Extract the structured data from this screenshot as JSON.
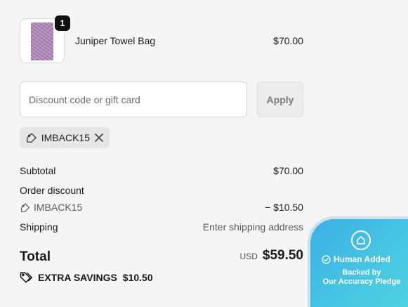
{
  "line_item": {
    "quantity": "1",
    "name": "Juniper Towel Bag",
    "price": "$70.00"
  },
  "discount": {
    "placeholder": "Discount code or gift card",
    "apply_label": "Apply",
    "applied_code": "IMBACK15"
  },
  "summary": {
    "subtotal_label": "Subtotal",
    "subtotal_value": "$70.00",
    "order_discount_label": "Order discount",
    "order_discount_code": "IMBACK15",
    "order_discount_value": "− $10.50",
    "shipping_label": "Shipping",
    "shipping_value": "Enter shipping address",
    "total_label": "Total",
    "total_currency": "USD",
    "total_value": "$59.50",
    "savings_label": "EXTRA SAVINGS",
    "savings_value": "$10.50"
  },
  "badge": {
    "title": "Human Added",
    "line1": "Backed by",
    "line2": "Our Accuracy Pledge"
  },
  "icons": {
    "tag": "tag-icon",
    "remove": "close-icon",
    "savings": "tags-icon",
    "badge_logo": "home-icon",
    "badge_check": "check-circle-icon"
  },
  "colors": {
    "background": "#f5f5f5",
    "badge_gradient_start": "#3db0e6",
    "badge_gradient_end": "#4fd5e0",
    "product_art": "#a884b2"
  }
}
